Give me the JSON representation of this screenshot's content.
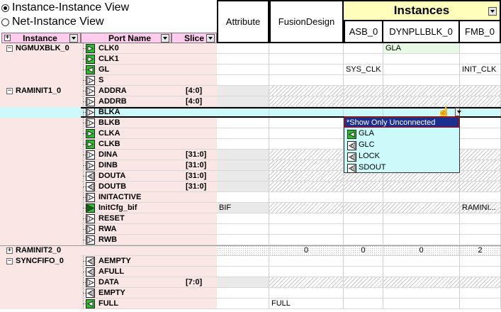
{
  "view_options": {
    "instance_instance": "Instance-Instance View",
    "net_instance": "Net-Instance View",
    "selected": "instance_instance"
  },
  "left_headers": {
    "instance": "Instance",
    "port_name": "Port Name",
    "slice": "Slice"
  },
  "columns": {
    "attribute": "Attribute",
    "fusion_design": "FusionDesign",
    "instances_group": "Instances",
    "asb": "ASB_0",
    "dynpll": "DYNPLLBLK_0",
    "fmb": "FMB_0"
  },
  "rows": [
    {
      "expander": "−",
      "instance": "NGMUXBLK_0",
      "port": "CLK0",
      "icon": "clock-in-icon",
      "slice": "",
      "attr": "",
      "fusion": "",
      "asb": "",
      "dyn": "GLA",
      "fmb": "",
      "dyn_bg": "green"
    },
    {
      "expander": "",
      "instance": "",
      "port": "CLK1",
      "icon": "clock-in-icon",
      "slice": "",
      "attr": "",
      "fusion": "",
      "asb": "",
      "dyn": "",
      "fmb": ""
    },
    {
      "expander": "",
      "instance": "",
      "port": "GL",
      "icon": "clock-out-icon",
      "slice": "",
      "attr": "",
      "fusion": "",
      "asb": "SYS_CLK",
      "dyn": "",
      "fmb": "INIT_CLK"
    },
    {
      "expander": "",
      "instance": "",
      "port": "S",
      "icon": "input-icon",
      "slice": "",
      "attr": "",
      "fusion": "",
      "asb": "",
      "dyn": "",
      "fmb": ""
    },
    {
      "expander": "−",
      "instance": "RAMINIT1_0",
      "port": "ADDRA",
      "icon": "input-icon",
      "slice": "[4:0]",
      "attr": "",
      "fusion": "",
      "asb": "",
      "dyn": "",
      "fmb": "",
      "attr_bg": "gray",
      "hatch": true
    },
    {
      "expander": "",
      "instance": "",
      "port": "ADDRB",
      "icon": "input-icon",
      "slice": "[4:0]",
      "attr": "",
      "fusion": "",
      "asb": "",
      "dyn": "",
      "fmb": "",
      "attr_bg": "gray",
      "hatch": true
    },
    {
      "expander": "",
      "instance": "",
      "port": "BLKA",
      "icon": "input-icon",
      "slice": "",
      "attr": "",
      "fusion": "",
      "asb": "",
      "dyn": "",
      "fmb": "",
      "selected": true
    },
    {
      "expander": "",
      "instance": "",
      "port": "BLKB",
      "icon": "input-icon",
      "slice": "",
      "attr": "",
      "fusion": "",
      "asb": "",
      "dyn": "",
      "fmb": ""
    },
    {
      "expander": "",
      "instance": "",
      "port": "CLKA",
      "icon": "clock-in-icon",
      "slice": "",
      "attr": "",
      "fusion": "",
      "asb": "",
      "dyn": "",
      "fmb": ""
    },
    {
      "expander": "",
      "instance": "",
      "port": "CLKB",
      "icon": "clock-in-icon",
      "slice": "",
      "attr": "",
      "fusion": "",
      "asb": "",
      "dyn": "",
      "fmb": ""
    },
    {
      "expander": "",
      "instance": "",
      "port": "DINA",
      "icon": "input-icon",
      "slice": "[31:0]",
      "attr": "",
      "fusion": "",
      "asb": "",
      "dyn": "",
      "fmb": "",
      "attr_bg": "gray",
      "hatch": true
    },
    {
      "expander": "",
      "instance": "",
      "port": "DINB",
      "icon": "input-icon",
      "slice": "[31:0]",
      "attr": "",
      "fusion": "",
      "asb": "",
      "dyn": "",
      "fmb": "",
      "attr_bg": "gray",
      "hatch": true
    },
    {
      "expander": "",
      "instance": "",
      "port": "DOUTA",
      "icon": "output-icon",
      "slice": "[31:0]",
      "attr": "",
      "fusion": "",
      "asb": "",
      "dyn": "",
      "fmb": "",
      "attr_bg": "gray",
      "hatch": true
    },
    {
      "expander": "",
      "instance": "",
      "port": "DOUTB",
      "icon": "output-icon",
      "slice": "[31:0]",
      "attr": "",
      "fusion": "",
      "asb": "",
      "dyn": "",
      "fmb": "",
      "attr_bg": "gray",
      "hatch": true
    },
    {
      "expander": "",
      "instance": "",
      "port": "INITACTIVE",
      "icon": "input-icon",
      "slice": "",
      "attr": "",
      "fusion": "",
      "asb": "",
      "dyn": "",
      "fmb": ""
    },
    {
      "expander": "",
      "instance": "",
      "port": "InitCfg_bif",
      "icon": "bus-icon",
      "slice": "",
      "attr": "BIF",
      "fusion": "",
      "asb": "",
      "dyn": "",
      "fmb": "RAMINI...",
      "attr_bg": "gray",
      "hatch": true
    },
    {
      "expander": "",
      "instance": "",
      "port": "RESET",
      "icon": "input-icon",
      "slice": "",
      "attr": "",
      "fusion": "",
      "asb": "",
      "dyn": "",
      "fmb": ""
    },
    {
      "expander": "",
      "instance": "",
      "port": "RWA",
      "icon": "input-icon",
      "slice": "",
      "attr": "",
      "fusion": "",
      "asb": "",
      "dyn": "",
      "fmb": ""
    },
    {
      "expander": "",
      "instance": "",
      "port": "RWB",
      "icon": "input-icon",
      "slice": "",
      "attr": "",
      "fusion": "",
      "asb": "",
      "dyn": "",
      "fmb": ""
    },
    {
      "expander": "+",
      "instance": "RAMINIT2_0",
      "port": "",
      "icon": "",
      "slice": "",
      "attr": "",
      "fusion": "0",
      "asb": "0",
      "dyn": "0",
      "fmb": "2",
      "summary": true
    },
    {
      "expander": "−",
      "instance": "SYNCFIFO_0",
      "port": "AEMPTY",
      "icon": "output-icon",
      "slice": "",
      "attr": "",
      "fusion": "",
      "asb": "",
      "dyn": "",
      "fmb": ""
    },
    {
      "expander": "",
      "instance": "",
      "port": "AFULL",
      "icon": "output-icon",
      "slice": "",
      "attr": "",
      "fusion": "",
      "asb": "",
      "dyn": "",
      "fmb": ""
    },
    {
      "expander": "",
      "instance": "",
      "port": "DATA",
      "icon": "input-icon",
      "slice": "[7:0]",
      "attr": "",
      "fusion": "",
      "asb": "",
      "dyn": "",
      "fmb": "",
      "attr_bg": "gray",
      "hatch": true
    },
    {
      "expander": "",
      "instance": "",
      "port": "EMPTY",
      "icon": "output-icon",
      "slice": "",
      "attr": "",
      "fusion": "",
      "asb": "",
      "dyn": "",
      "fmb": ""
    },
    {
      "expander": "",
      "instance": "",
      "port": "FULL",
      "icon": "clock-out-icon",
      "slice": "",
      "attr": "",
      "fusion": "FULL",
      "asb": "",
      "dyn": "",
      "fmb": ""
    }
  ],
  "dropdown": {
    "header": "*Show Only Unconnected",
    "items": [
      {
        "label": "GLA",
        "icon": "clock-out-icon"
      },
      {
        "label": "GLC",
        "icon": "output-icon"
      },
      {
        "label": "LOCK",
        "icon": "output-icon"
      },
      {
        "label": "SDOUT",
        "icon": "output-icon"
      }
    ]
  },
  "colors": {
    "left_bg": "#fbe6e6",
    "header_pink": "#ffccee",
    "instances_yellow": "#ffffbb",
    "selected_row": "#ccf9f9",
    "menu_bg": "#ccf9f9",
    "menu_header": "#1b2f8e",
    "clock_green": "#2bbf2b"
  }
}
